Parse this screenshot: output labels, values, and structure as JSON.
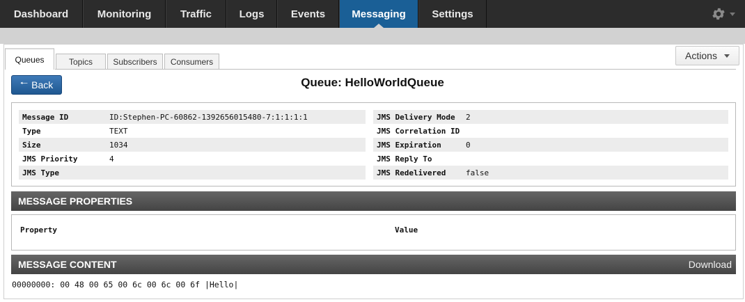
{
  "nav": {
    "items": [
      {
        "label": "Dashboard"
      },
      {
        "label": "Monitoring"
      },
      {
        "label": "Traffic"
      },
      {
        "label": "Logs"
      },
      {
        "label": "Events"
      },
      {
        "label": "Messaging"
      },
      {
        "label": "Settings"
      }
    ],
    "active": "Messaging",
    "settings_icon": "gear-icon"
  },
  "tabs": [
    {
      "label": "Queues",
      "active": true
    },
    {
      "label": "Topics",
      "active": false
    },
    {
      "label": "Subscribers",
      "active": false
    },
    {
      "label": "Consumers",
      "active": false
    }
  ],
  "actions_label": "Actions",
  "back_label": "Back",
  "page_title": "Queue: HelloWorldQueue",
  "headers": {
    "left": [
      {
        "key": "Message ID",
        "value": "ID:Stephen-PC-60862-1392656015480-7:1:1:1:1"
      },
      {
        "key": "Type",
        "value": "TEXT"
      },
      {
        "key": "Size",
        "value": "1034"
      },
      {
        "key": "JMS Priority",
        "value": "4"
      },
      {
        "key": "JMS Type",
        "value": ""
      }
    ],
    "right": [
      {
        "key": "JMS Delivery Mode",
        "value": "2"
      },
      {
        "key": "JMS Correlation ID",
        "value": ""
      },
      {
        "key": "JMS Expiration",
        "value": "0"
      },
      {
        "key": "JMS Reply To",
        "value": ""
      },
      {
        "key": "JMS Redelivered",
        "value": "false"
      }
    ]
  },
  "properties": {
    "title": "MESSAGE PROPERTIES",
    "col_property": "Property",
    "col_value": "Value"
  },
  "content": {
    "title": "MESSAGE CONTENT",
    "download_label": "Download",
    "hex_line": "00000000: 00 48 00 65 00 6c 00 6c 00 6f |Hello|"
  },
  "colors": {
    "nav_bg": "#2c2c2c",
    "nav_active": "#1a5f96",
    "back_button": "#2a66a3",
    "section_bar": "#555555"
  }
}
